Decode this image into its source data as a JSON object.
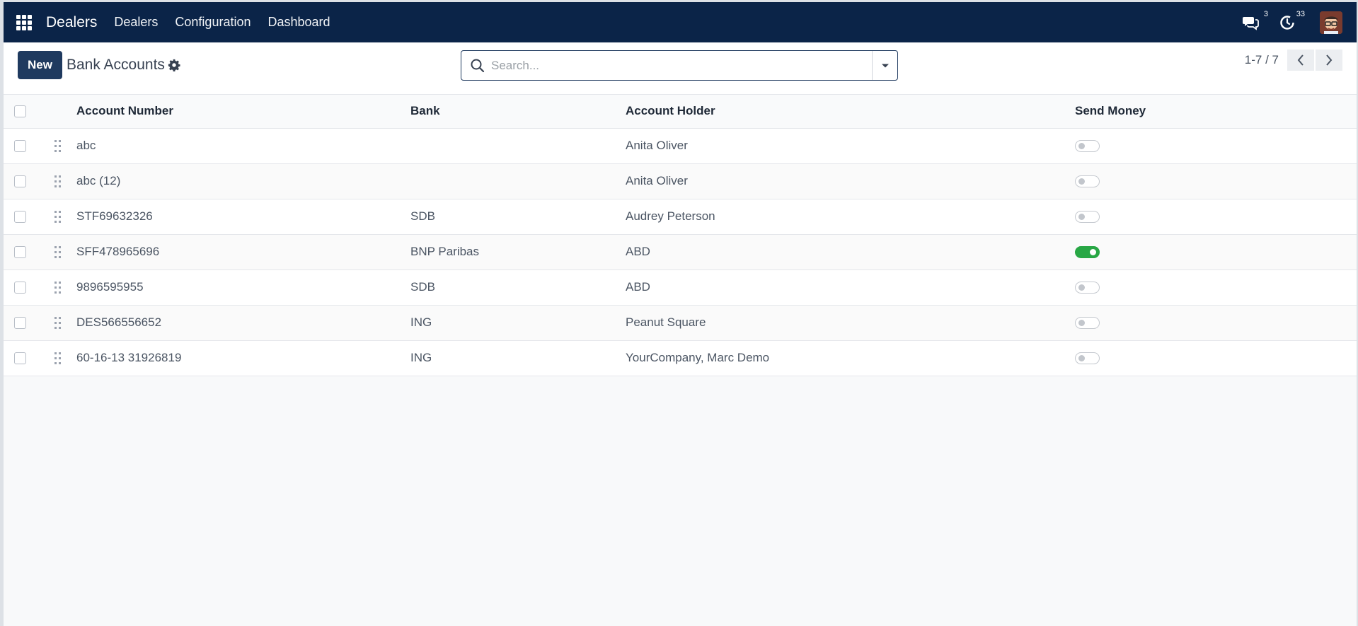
{
  "navbar": {
    "brand": "Dealers",
    "menu": [
      "Dealers",
      "Configuration",
      "Dashboard"
    ],
    "messages_count": "3",
    "activities_count": "33",
    "icons": [
      "apps-grid-icon",
      "chat-icon",
      "clock-icon",
      "user-avatar"
    ]
  },
  "control_panel": {
    "new_label": "New",
    "title": "Bank Accounts",
    "search_placeholder": "Search...",
    "pager": "1-7 / 7"
  },
  "table": {
    "headers": [
      "Account Number",
      "Bank",
      "Account Holder",
      "Send Money"
    ],
    "rows": [
      {
        "account": "abc",
        "bank": "",
        "holder": "Anita Oliver",
        "send_money": false
      },
      {
        "account": "abc (12)",
        "bank": "",
        "holder": "Anita Oliver",
        "send_money": false
      },
      {
        "account": "STF69632326",
        "bank": "SDB",
        "holder": "Audrey Peterson",
        "send_money": false
      },
      {
        "account": "SFF478965696",
        "bank": "BNP Paribas",
        "holder": "ABD",
        "send_money": true
      },
      {
        "account": "9896595955",
        "bank": "SDB",
        "holder": "ABD",
        "send_money": false
      },
      {
        "account": "DES566556652",
        "bank": "ING",
        "holder": "Peanut Square",
        "send_money": false
      },
      {
        "account": "60-16-13 31926819",
        "bank": "ING",
        "holder": "YourCompany, Marc Demo",
        "send_money": false
      }
    ]
  },
  "colors": {
    "navbar_bg": "#0b2448",
    "primary_button": "#1f3a5f",
    "toggle_on": "#28a745"
  }
}
